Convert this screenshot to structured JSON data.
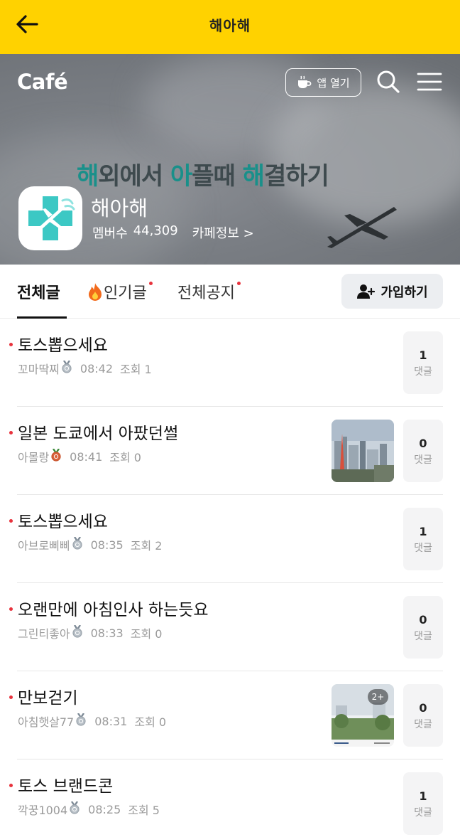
{
  "topbar": {
    "title": "해아해",
    "back_icon": "arrow-left-icon"
  },
  "header": {
    "logo": "Café",
    "app_open_label": "앱 열기",
    "banner_text_parts": [
      "해",
      "외에서 ",
      "아",
      "플때 ",
      "해",
      "결하기"
    ],
    "cafe_name": "해아해",
    "members_label": "멤버수",
    "members_count": "44,309",
    "cafe_info_label": "카페정보 >"
  },
  "tabs": {
    "all": "전체글",
    "popular": "인기글",
    "notice": "전체공지",
    "join_button": "가입하기"
  },
  "colors": {
    "brand_yellow": "#ffd200",
    "new_dot": "#e8323c",
    "banner_highlight": "#19908a"
  },
  "posts": [
    {
      "title": "토스뽑으세요",
      "author": "꼬마딱찌",
      "medal": "silver",
      "time": "08:42",
      "views": "조회 1",
      "comments": "1",
      "comments_label": "댓글",
      "thumbnail": false
    },
    {
      "title": "일본 도쿄에서 아팠던썰",
      "author": "아몰랑",
      "medal": "bronze",
      "time": "08:41",
      "views": "조회 0",
      "comments": "0",
      "comments_label": "댓글",
      "thumbnail": true,
      "thumbnail_badge": ""
    },
    {
      "title": "토스뽑으세요",
      "author": "아브로삐삐",
      "medal": "silver",
      "time": "08:35",
      "views": "조회 2",
      "comments": "1",
      "comments_label": "댓글",
      "thumbnail": false
    },
    {
      "title": "오랜만에 아침인사 하는듯요",
      "author": "그린티좋아",
      "medal": "silver",
      "time": "08:33",
      "views": "조회 0",
      "comments": "0",
      "comments_label": "댓글",
      "thumbnail": false
    },
    {
      "title": "만보걷기",
      "author": "아침햇살77",
      "medal": "silver",
      "time": "08:31",
      "views": "조회 0",
      "comments": "0",
      "comments_label": "댓글",
      "thumbnail": true,
      "thumbnail_badge": "2+"
    },
    {
      "title": "토스 브랜드콘",
      "author": "깍꿍1004",
      "medal": "silver",
      "time": "08:25",
      "views": "조회 5",
      "comments": "1",
      "comments_label": "댓글",
      "thumbnail": false
    }
  ]
}
